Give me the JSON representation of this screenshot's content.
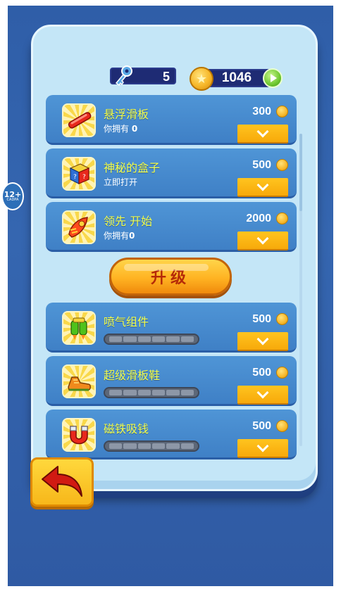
{
  "currency": {
    "keys": "5",
    "coins": "1046"
  },
  "age_rating": {
    "value": "12+",
    "org": "CADPA"
  },
  "items": [
    {
      "name": "悬浮滑板",
      "owned_label": "你拥有",
      "owned_value": "0",
      "price": "300",
      "icon": "hoverboard-icon"
    },
    {
      "name": "神秘的盒子",
      "subtitle": "立即打开",
      "price": "500",
      "icon": "mystery-box-icon"
    },
    {
      "name": "领先 开始",
      "owned_label": "你拥有",
      "owned_value": "0",
      "price": "2000",
      "icon": "headstart-icon"
    }
  ],
  "upgrade_label": "升级",
  "upgrades": [
    {
      "name": "喷气组件",
      "price": "500",
      "icon": "jetpack-icon",
      "level": 0,
      "max_level": 6
    },
    {
      "name": "超级滑板鞋",
      "price": "500",
      "icon": "super-sneakers-icon",
      "level": 0,
      "max_level": 6
    },
    {
      "name": "磁铁吸钱",
      "price": "500",
      "icon": "coin-magnet-icon",
      "level": 0,
      "max_level": 6
    }
  ],
  "colors": {
    "background": "#3566b0",
    "card": "#c4e6f7",
    "row": "#4f95d6",
    "title_yellow": "#f3ff4a",
    "buy_button": "#ffc41f",
    "upgrade_button": "#ffb322"
  }
}
